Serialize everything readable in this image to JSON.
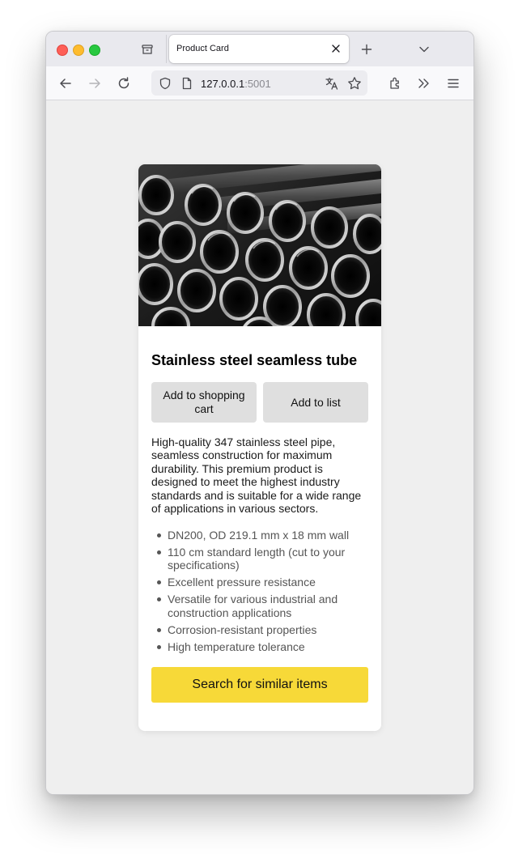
{
  "browser": {
    "tab": {
      "title": "Product Card"
    },
    "url": {
      "host": "127.0.0.1",
      "port": ":5001"
    }
  },
  "product": {
    "title": "Stainless steel seamless tube",
    "buttons": {
      "add_to_cart": "Add to shopping cart",
      "add_to_list": "Add to list",
      "search_similar": "Search for similar items"
    },
    "description": "High-quality 347 stainless steel pipe, seamless construction for maximum durability. This premium product is designed to meet the highest industry standards and is suitable for a wide range of applications in various sectors.",
    "features": [
      "DN200, OD 219.1 mm x 18 mm wall",
      "110 cm standard length (cut to your specifications)",
      "Excellent pressure resistance",
      "Versatile for various industrial and construction applications",
      "Corrosion-resistant properties",
      "High temperature tolerance"
    ]
  },
  "colors": {
    "accent_button": "#f7d938",
    "secondary_button": "#dfdfdf",
    "page_background": "#efefef"
  }
}
